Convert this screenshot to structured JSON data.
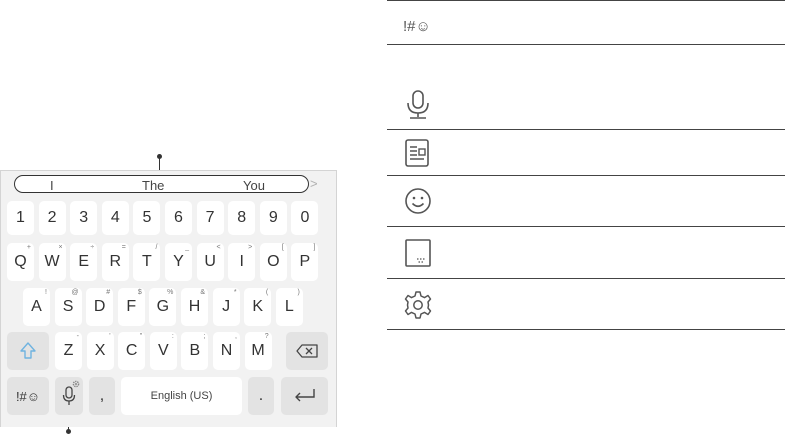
{
  "suggestions": [
    "I",
    "The",
    "You"
  ],
  "number_row": [
    "1",
    "2",
    "3",
    "4",
    "5",
    "6",
    "7",
    "8",
    "9",
    "0"
  ],
  "row_q": [
    {
      "label": "Q",
      "hint": "+"
    },
    {
      "label": "W",
      "hint": "×"
    },
    {
      "label": "E",
      "hint": "÷"
    },
    {
      "label": "R",
      "hint": "="
    },
    {
      "label": "T",
      "hint": "/"
    },
    {
      "label": "Y",
      "hint": "_"
    },
    {
      "label": "U",
      "hint": "<"
    },
    {
      "label": "I",
      "hint": ">"
    },
    {
      "label": "O",
      "hint": "["
    },
    {
      "label": "P",
      "hint": "]"
    }
  ],
  "row_a": [
    {
      "label": "A",
      "hint": "!"
    },
    {
      "label": "S",
      "hint": "@"
    },
    {
      "label": "D",
      "hint": "#"
    },
    {
      "label": "F",
      "hint": "$"
    },
    {
      "label": "G",
      "hint": "%"
    },
    {
      "label": "H",
      "hint": "&"
    },
    {
      "label": "J",
      "hint": "*"
    },
    {
      "label": "K",
      "hint": "("
    },
    {
      "label": "L",
      "hint": ")"
    }
  ],
  "row_z": [
    {
      "label": "Z",
      "hint": "-"
    },
    {
      "label": "X",
      "hint": "'"
    },
    {
      "label": "C",
      "hint": "\""
    },
    {
      "label": "V",
      "hint": ":"
    },
    {
      "label": "B",
      "hint": ";"
    },
    {
      "label": "N",
      "hint": ","
    },
    {
      "label": "M",
      "hint": "?"
    }
  ],
  "bottom_row": {
    "symbols_label": "!#☺",
    "comma": ",",
    "space_label": "English (US)",
    "period": "."
  },
  "icons": {
    "shift": "shift-arrow-icon",
    "backspace": "backspace-icon",
    "mic": "microphone-icon",
    "enter": "enter-icon",
    "settings_small": "gear-icon"
  },
  "menu": {
    "symbols_label": "!#☺",
    "items": [
      "microphone-icon",
      "clipboard-icon",
      "emoji-icon",
      "keyboard-mode-icon",
      "settings-icon"
    ]
  },
  "colors": {
    "keyboard_bg": "#f2f2f2",
    "key_bg": "#ffffff",
    "shift_blue": "#6fb3e0"
  }
}
